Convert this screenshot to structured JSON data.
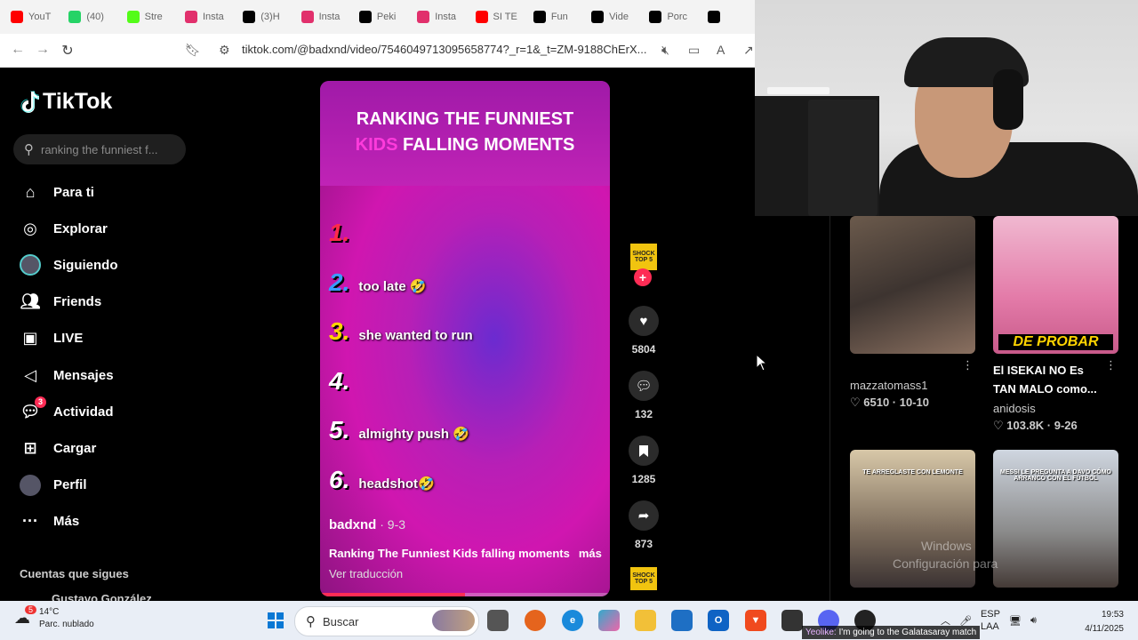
{
  "tabs": [
    {
      "label": "YouT",
      "icon": "youtube-icon",
      "color": "#ff0000"
    },
    {
      "label": "(40)",
      "icon": "whatsapp-icon",
      "color": "#25d366"
    },
    {
      "label": "Stre",
      "icon": "kick-icon",
      "color": "#53fc18"
    },
    {
      "label": "Insta",
      "icon": "instagram-icon",
      "color": "#e1306c"
    },
    {
      "label": "(3)H",
      "icon": "tiktok-icon",
      "color": "#000000"
    },
    {
      "label": "Insta",
      "icon": "instagram-icon",
      "color": "#e1306c"
    },
    {
      "label": "Peki",
      "icon": "tiktok-icon",
      "color": "#000000"
    },
    {
      "label": "Insta",
      "icon": "instagram-icon",
      "color": "#e1306c"
    },
    {
      "label": "SI TE",
      "icon": "youtube-icon",
      "color": "#ff0000"
    },
    {
      "label": "Fun",
      "icon": "tiktok-icon",
      "color": "#000000"
    },
    {
      "label": "Vide",
      "icon": "tiktok-icon",
      "color": "#000000"
    },
    {
      "label": "Porc",
      "icon": "tiktok-icon",
      "color": "#000000"
    },
    {
      "label": "",
      "icon": "tiktok-icon",
      "color": "#000000"
    }
  ],
  "browser": {
    "url": "tiktok.com/@badxnd/video/7546049713095658774?_r=1&_t=ZM-9188ChErX..."
  },
  "tiktok": {
    "logo": "TikTok",
    "search_placeholder": "ranking the funniest f...",
    "nav": [
      {
        "label": "Para ti",
        "icon": "home-icon"
      },
      {
        "label": "Explorar",
        "icon": "compass-icon"
      },
      {
        "label": "Siguiendo",
        "icon": "following-avatar-icon"
      },
      {
        "label": "Friends",
        "icon": "friends-icon"
      },
      {
        "label": "LIVE",
        "icon": "live-icon"
      },
      {
        "label": "Mensajes",
        "icon": "messages-icon"
      },
      {
        "label": "Actividad",
        "icon": "activity-icon",
        "badge": "3"
      },
      {
        "label": "Cargar",
        "icon": "upload-icon"
      },
      {
        "label": "Perfil",
        "icon": "profile-avatar-icon"
      },
      {
        "label": "Más",
        "icon": "more-icon"
      }
    ],
    "following_title": "Cuentas que sigues",
    "following_user": "Gustavo González"
  },
  "video": {
    "title_line1": "RANKING THE FUNNIEST",
    "title_kids": "KIDS",
    "title_line2_rest": " FALLING MOMENTS",
    "ranks": [
      {
        "num": "1.",
        "label": "",
        "color": "#ff2a4a"
      },
      {
        "num": "2.",
        "label": "too late 🤣",
        "color": "#3a9bff"
      },
      {
        "num": "3.",
        "label": "she wanted to run",
        "color": "#ffd400"
      },
      {
        "num": "4.",
        "label": "",
        "color": "#ffffff"
      },
      {
        "num": "5.",
        "label": "almighty push 🤣",
        "color": "#ffffff"
      },
      {
        "num": "6.",
        "label": "headshot🤣",
        "color": "#ffffff"
      }
    ],
    "author": "badxnd",
    "date": " · 9-3",
    "description": "Ranking The Funniest Kids falling moments",
    "more": "más",
    "translate": "Ver traducción",
    "progress": 0.5,
    "avatar_text": "SHOCK TOP 5",
    "likes": "5804",
    "comments": "132",
    "saves": "1285",
    "shares": "873"
  },
  "recommended": [
    {
      "title": "",
      "author": "mazzatomass1",
      "stats": "♡ 6510 · 10-10",
      "overlay": ""
    },
    {
      "title": "El ISEKAI NO Es TAN MALO como...",
      "author": "anidosis",
      "stats": "♡ 103.8K · 9-26",
      "overlay": "DE PROBAR"
    },
    {
      "title": "",
      "author": "",
      "stats": "",
      "overlay": "TE ARREGLASTE CON LEMONTE"
    },
    {
      "title": "",
      "author": "",
      "stats": "",
      "overlay": "MESSI LE PREGUNTA A DAVO CÓMO ARRANCÓ CON EL FÚTBOL"
    }
  ],
  "watermark": {
    "line1": "Windows",
    "line2": "Configuración para"
  },
  "taskbar": {
    "badge": "5",
    "temp": "14°C",
    "weather": "Parc. nublado",
    "search": "Buscar",
    "lang": "ESP",
    "lang2": "LAA",
    "time": "19:53",
    "date": "4/11/2025",
    "subtitle_who": "Yeolike:",
    "subtitle_text": " I'm going to the Galatasaray match"
  }
}
